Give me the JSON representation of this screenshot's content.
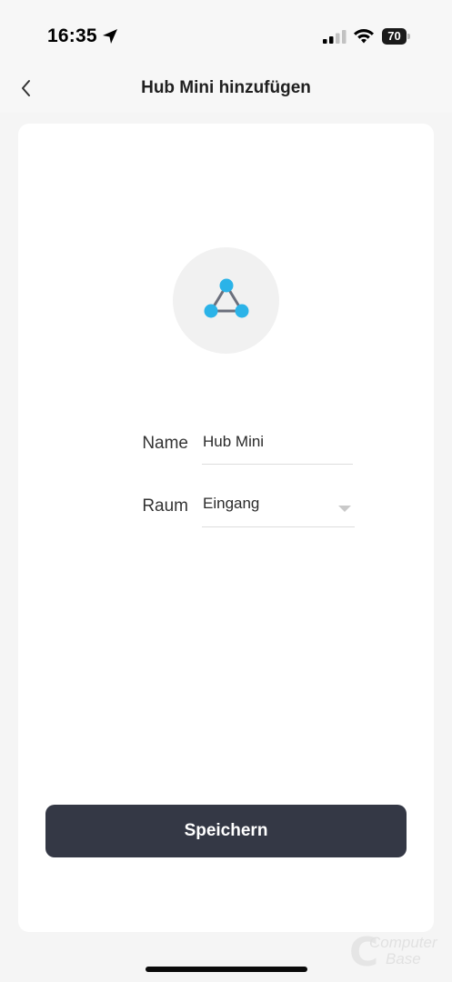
{
  "status_bar": {
    "time": "16:35",
    "battery_level": "70",
    "icons": [
      "location-arrow-icon",
      "cellular-signal-icon",
      "wifi-icon",
      "battery-icon"
    ]
  },
  "navbar": {
    "title": "Hub Mini hinzufügen",
    "back_icon": "chevron-left-icon"
  },
  "device": {
    "icon": "hub-triangle-icon",
    "icon_colors": {
      "nodes": "#2bb3e8",
      "edges": "#6b6f7c",
      "circle": "#f1f1f1"
    }
  },
  "form": {
    "name_label": "Name",
    "name_value": "Hub Mini",
    "room_label": "Raum",
    "room_value": "Eingang"
  },
  "actions": {
    "save_label": "Speichern"
  },
  "watermark": {
    "line1": "Computer",
    "line2": "Base"
  },
  "colors": {
    "button_bg": "#343845",
    "background": "#f5f5f5",
    "card": "#ffffff"
  }
}
